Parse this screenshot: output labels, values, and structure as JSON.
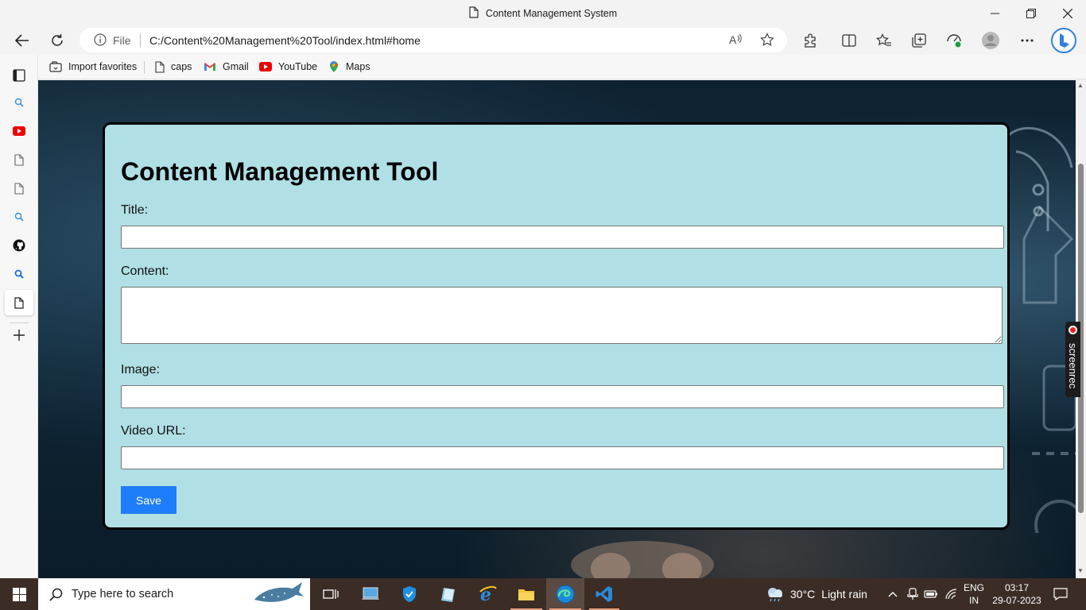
{
  "window": {
    "tab_title": "Content Management System"
  },
  "address_bar": {
    "scheme_label": "File",
    "url": "C:/Content%20Management%20Tool/index.html#home"
  },
  "favorites": [
    {
      "label": "Import favorites",
      "icon": "import-icon"
    },
    {
      "label": "caps",
      "icon": "doc-icon"
    },
    {
      "label": "Gmail",
      "icon": "gmail-icon"
    },
    {
      "label": "YouTube",
      "icon": "youtube-icon"
    },
    {
      "label": "Maps",
      "icon": "maps-icon"
    }
  ],
  "form": {
    "heading": "Content Management Tool",
    "title_label": "Title:",
    "title_value": "",
    "content_label": "Content:",
    "content_value": "",
    "image_label": "Image:",
    "image_value": "",
    "video_label": "Video URL:",
    "video_value": "",
    "save_label": "Save"
  },
  "overlay": {
    "screenrec_label": "screenrec"
  },
  "taskbar": {
    "search_placeholder": "Type here to search",
    "weather_temp": "30°C",
    "weather_desc": "Light rain",
    "language_line1": "ENG",
    "language_line2": "IN",
    "time": "03:17",
    "date": "29-07-2023"
  },
  "colors": {
    "card_background": "#b0dfe5",
    "save_button": "#1e7dfa",
    "taskbar": "#3b2c25"
  }
}
